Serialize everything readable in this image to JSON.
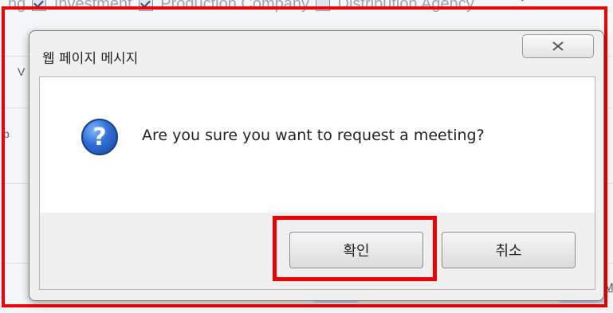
{
  "background": {
    "tab_fragments": [
      "ng",
      "Investment",
      "Production Company",
      "Distribution Agency"
    ],
    "left_fragments": [
      "V",
      "p"
    ],
    "right_fragment": "M"
  },
  "dialog": {
    "title": "웹 페이지 메시지",
    "message": "Are you sure you want to request a meeting?",
    "icon": "question-icon",
    "close_icon": "close-icon",
    "buttons": {
      "ok_label": "확인",
      "cancel_label": "취소"
    }
  },
  "annotations": {
    "highlight_color": "#ee0000"
  }
}
